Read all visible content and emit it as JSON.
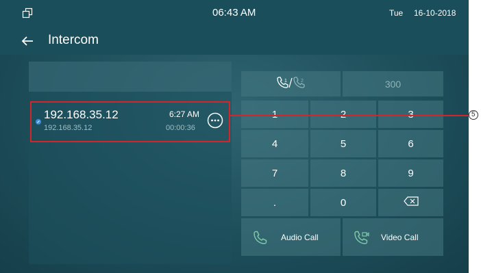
{
  "status_bar": {
    "time": "06:43 AM",
    "day": "Tue",
    "date": "16-10-2018"
  },
  "app_bar": {
    "title": "Intercom"
  },
  "call_log": {
    "items": [
      {
        "name": "192.168.35.12",
        "address": "192.168.35.12",
        "time": "6:27 AM",
        "duration": "00:00:36"
      }
    ]
  },
  "keypad": {
    "number_display": "300",
    "keys": [
      "1",
      "2",
      "3",
      "4",
      "5",
      "6",
      "7",
      "8",
      "9",
      ".",
      "0"
    ],
    "audio_call_label": "Audio Call",
    "video_call_label": "Video Call"
  },
  "callout": {
    "label": "5"
  },
  "colors": {
    "background": "#1d4f5b",
    "bar": "#1a4e5b",
    "key": "#4b7d87",
    "highlight": "#d4252a",
    "call_icon": "#7ec8a8"
  }
}
